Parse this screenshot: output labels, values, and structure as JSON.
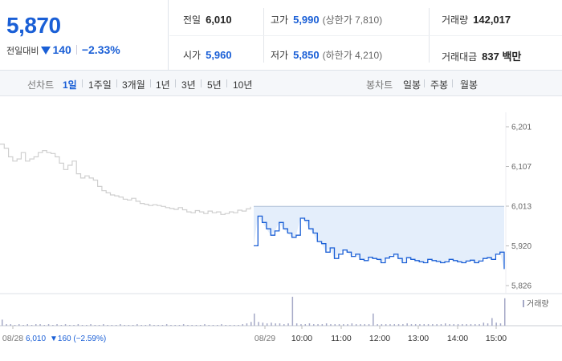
{
  "summary": {
    "price": "5,870",
    "change_label": "전일대비",
    "change_abs": "140",
    "change_pct": "−2.33%"
  },
  "stats": {
    "prev_label": "전일",
    "prev_value": "6,010",
    "high_label": "고가",
    "high_value": "5,990",
    "upper_limit": "(상한가 7,810)",
    "volume_label": "거래량",
    "volume_value": "142,017",
    "open_label": "시가",
    "open_value": "5,960",
    "low_label": "저가",
    "low_value": "5,850",
    "lower_limit": "(하한가 4,210)",
    "amount_label": "거래대금",
    "amount_value": "837 백만"
  },
  "tabs": {
    "line_label": "선차트",
    "line_items": [
      "1일",
      "1주일",
      "3개월",
      "1년",
      "3년",
      "5년",
      "10년"
    ],
    "active_line": "1일",
    "candle_label": "봉차트",
    "candle_items": [
      "일봉",
      "주봉",
      "월봉"
    ]
  },
  "colors": {
    "accent": "#1a5fd6",
    "prev_line": "#cfcfcf",
    "fill": "#e4eefb",
    "volume": "#a4a8c6"
  },
  "chart_data": {
    "type": "line",
    "y_ticks": [
      "6,201",
      "6,107",
      "6,013",
      "5,920",
      "5,826"
    ],
    "ylim": [
      5826,
      6201
    ],
    "x_ticks": [
      "08/28",
      "08/29",
      "10:00",
      "11:00",
      "12:00",
      "13:00",
      "14:00",
      "15:00"
    ],
    "prev_close": 6013,
    "legend_volume": "거래량",
    "prev_day_caption_date": "08/28",
    "prev_day_caption_price": "6,010",
    "prev_day_caption_change": "▼160 (−2.59%)",
    "series": [
      {
        "day": "08/28",
        "values": [
          6160,
          6150,
          6130,
          6120,
          6125,
          6140,
          6120,
          6125,
          6130,
          6140,
          6145,
          6140,
          6138,
          6130,
          6115,
          6100,
          6110,
          6120,
          6090,
          6080,
          6085,
          6080,
          6075,
          6060,
          6050,
          6045,
          6040,
          6038,
          6035,
          6030,
          6028,
          6032,
          6025,
          6020,
          6018,
          6015,
          6017,
          6015,
          6013,
          6010,
          6008,
          6006,
          6010,
          6005,
          6000,
          5998,
          6003,
          6000,
          5996,
          6002,
          5998,
          6000,
          5994,
          5996,
          6000,
          5998,
          6004,
          6002,
          6007,
          6012
        ]
      },
      {
        "day": "08/29",
        "values": [
          5920,
          5990,
          5975,
          5960,
          5945,
          5955,
          5975,
          5960,
          5950,
          5940,
          5945,
          5985,
          5980,
          5960,
          5950,
          5930,
          5925,
          5905,
          5915,
          5890,
          5900,
          5910,
          5905,
          5895,
          5900,
          5888,
          5885,
          5893,
          5890,
          5888,
          5880,
          5891,
          5895,
          5900,
          5890,
          5880,
          5892,
          5888,
          5885,
          5882,
          5880,
          5888,
          5885,
          5883,
          5880,
          5882,
          5888,
          5885,
          5882,
          5880,
          5884,
          5886,
          5880,
          5884,
          5890,
          5892,
          5888,
          5900,
          5905,
          5865
        ]
      }
    ],
    "volume": {
      "day1": [
        8,
        2,
        2,
        1,
        2,
        1,
        2,
        1,
        2,
        2,
        1,
        2,
        1,
        2,
        1,
        2,
        1,
        1,
        2,
        1,
        1,
        2,
        1,
        1,
        2,
        1,
        1,
        1,
        2,
        1,
        1,
        1,
        2,
        1,
        1,
        2,
        1,
        1,
        1,
        2,
        1,
        1,
        1,
        2,
        1,
        1,
        1,
        1,
        2,
        1,
        1,
        1,
        2,
        1,
        1,
        1,
        1,
        2,
        3,
        5
      ],
      "day2": [
        16,
        5,
        4,
        3,
        4,
        3,
        3,
        2,
        3,
        38,
        3,
        2,
        2,
        3,
        2,
        2,
        2,
        3,
        2,
        2,
        2,
        2,
        2,
        3,
        2,
        2,
        2,
        2,
        16,
        2,
        2,
        2,
        2,
        2,
        2,
        2,
        3,
        2,
        2,
        2,
        2,
        2,
        2,
        2,
        2,
        3,
        2,
        2,
        2,
        2,
        2,
        2,
        2,
        2,
        4,
        3,
        10,
        4,
        3,
        36
      ]
    }
  }
}
